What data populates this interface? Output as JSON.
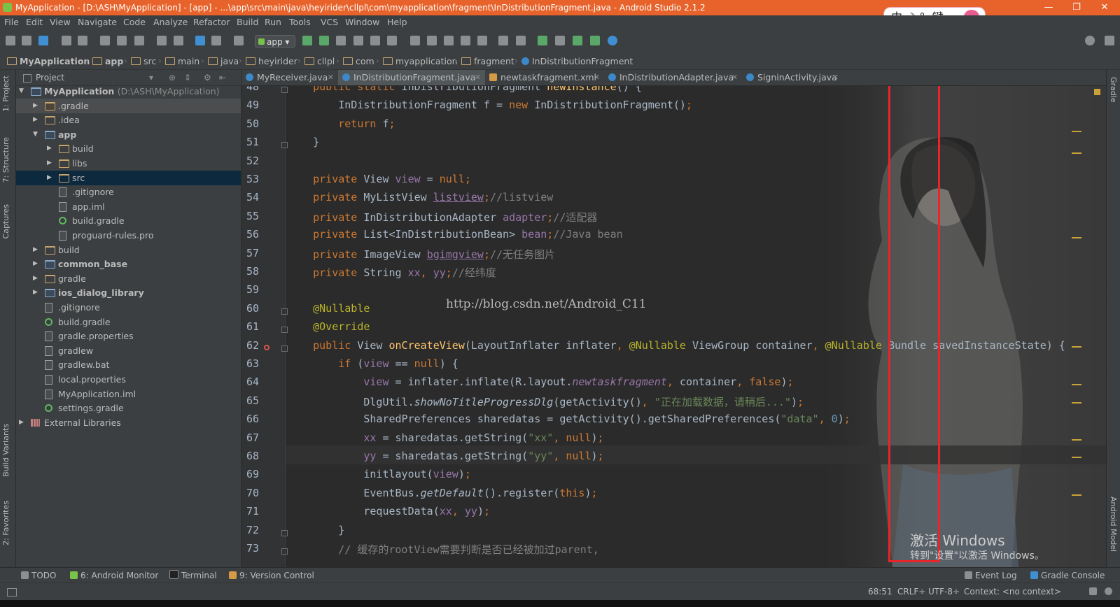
{
  "window": {
    "title": "MyApplication - [D:\\ASH\\MyApplication] - [app] - ...\\app\\src\\main\\java\\heyirider\\cllpl\\com\\myapplication\\fragment\\InDistributionFragment.java - Android Studio 2.1.2",
    "minimize": "—",
    "restore": "❐",
    "close": "✕"
  },
  "ime": {
    "text": "中 ☽ °, 键"
  },
  "menu": [
    "File",
    "Edit",
    "View",
    "Navigate",
    "Code",
    "Analyze",
    "Refactor",
    "Build",
    "Run",
    "Tools",
    "VCS",
    "Window",
    "Help"
  ],
  "toolbar": {
    "run_config": "app"
  },
  "breadcrumb": [
    "MyApplication",
    "app",
    "src",
    "main",
    "java",
    "heyirider",
    "cllpl",
    "com",
    "myapplication",
    "fragment",
    "InDistributionFragment"
  ],
  "left_strip": [
    "1: Project",
    "7: Structure",
    "Captures",
    "Build Variants",
    "2: Favorites"
  ],
  "right_strip": [
    "Gradle",
    "Android Model"
  ],
  "project_panel": {
    "header": "Project",
    "tree": [
      {
        "label": "MyApplication",
        "path": "(D:\\ASH\\MyApplication)",
        "depth": 0,
        "expanded": true,
        "icon": "module-folder",
        "bold": true
      },
      {
        "label": ".gradle",
        "depth": 1,
        "expanded": false,
        "icon": "folder-mod"
      },
      {
        "label": ".idea",
        "depth": 1,
        "expanded": false,
        "icon": "folder"
      },
      {
        "label": "app",
        "depth": 1,
        "expanded": true,
        "icon": "module-folder",
        "bold": true
      },
      {
        "label": "build",
        "depth": 2,
        "expanded": false,
        "icon": "folder"
      },
      {
        "label": "libs",
        "depth": 2,
        "expanded": false,
        "icon": "folder"
      },
      {
        "label": "src",
        "depth": 2,
        "expanded": false,
        "icon": "folder",
        "selected": true
      },
      {
        "label": ".gitignore",
        "depth": 2,
        "icon": "file"
      },
      {
        "label": "app.iml",
        "depth": 2,
        "icon": "file"
      },
      {
        "label": "build.gradle",
        "depth": 2,
        "icon": "gradle"
      },
      {
        "label": "proguard-rules.pro",
        "depth": 2,
        "icon": "file"
      },
      {
        "label": "build",
        "depth": 1,
        "expanded": false,
        "icon": "folder"
      },
      {
        "label": "common_base",
        "depth": 1,
        "expanded": false,
        "icon": "module-folder",
        "bold": true
      },
      {
        "label": "gradle",
        "depth": 1,
        "expanded": false,
        "icon": "folder"
      },
      {
        "label": "ios_dialog_library",
        "depth": 1,
        "expanded": false,
        "icon": "module-folder",
        "bold": true
      },
      {
        "label": ".gitignore",
        "depth": 1,
        "icon": "file"
      },
      {
        "label": "build.gradle",
        "depth": 1,
        "icon": "gradle"
      },
      {
        "label": "gradle.properties",
        "depth": 1,
        "icon": "file"
      },
      {
        "label": "gradlew",
        "depth": 1,
        "icon": "file"
      },
      {
        "label": "gradlew.bat",
        "depth": 1,
        "icon": "file"
      },
      {
        "label": "local.properties",
        "depth": 1,
        "icon": "file"
      },
      {
        "label": "MyApplication.iml",
        "depth": 1,
        "icon": "file"
      },
      {
        "label": "settings.gradle",
        "depth": 1,
        "icon": "gradle"
      },
      {
        "label": "External Libraries",
        "depth": 0,
        "expanded": false,
        "icon": "library"
      }
    ]
  },
  "tabs": [
    {
      "label": "MyReceiver.java",
      "kind": "class"
    },
    {
      "label": "InDistributionFragment.java",
      "kind": "class",
      "active": true
    },
    {
      "label": "newtaskfragment.xml",
      "kind": "xml"
    },
    {
      "label": "InDistributionAdapter.java",
      "kind": "class"
    },
    {
      "label": "SigninActivity.java",
      "kind": "class"
    }
  ],
  "editor": {
    "watermark": "http://blog.csdn.net/Android_C11",
    "activation_title": "激活 Windows",
    "activation_sub": "转到\"设置\"以激活 Windows。",
    "colors": {
      "keyword": "#cc7832",
      "field": "#9876aa",
      "string": "#6a8759",
      "comment": "#808080",
      "annotation": "#bbb529",
      "method": "#ffc66d",
      "text": "#a9b7c6",
      "number": "#6897bb"
    },
    "lines": [
      {
        "n": "48",
        "seg": [
          [
            "    ",
            "text"
          ],
          [
            "public static ",
            "keyword"
          ],
          [
            "InDistributionFragment ",
            "text"
          ],
          [
            "newInstance",
            "method"
          ],
          [
            "() {",
            "text"
          ]
        ]
      },
      {
        "n": "49",
        "seg": [
          [
            "        InDistributionFragment ",
            "text"
          ],
          [
            "f",
            "text"
          ],
          [
            " = ",
            "text"
          ],
          [
            "new ",
            "keyword"
          ],
          [
            "InDistributionFragment()",
            "text"
          ],
          [
            ";",
            "keyword"
          ]
        ]
      },
      {
        "n": "50",
        "seg": [
          [
            "        ",
            "text"
          ],
          [
            "return ",
            "keyword"
          ],
          [
            "f",
            "text"
          ],
          [
            ";",
            "keyword"
          ]
        ]
      },
      {
        "n": "51",
        "seg": [
          [
            "    }",
            "text"
          ]
        ]
      },
      {
        "n": "52",
        "seg": []
      },
      {
        "n": "53",
        "seg": [
          [
            "    ",
            "text"
          ],
          [
            "private ",
            "keyword"
          ],
          [
            "View ",
            "text"
          ],
          [
            "view",
            "field"
          ],
          [
            " = ",
            "text"
          ],
          [
            "null",
            "keyword"
          ],
          [
            ";",
            "keyword"
          ]
        ]
      },
      {
        "n": "54",
        "seg": [
          [
            "    ",
            "text"
          ],
          [
            "private ",
            "keyword"
          ],
          [
            "MyListView ",
            "text"
          ],
          [
            "listview",
            "field"
          ],
          [
            ";",
            "keyword"
          ],
          [
            "//listview",
            "comment"
          ]
        ]
      },
      {
        "n": "55",
        "seg": [
          [
            "    ",
            "text"
          ],
          [
            "private ",
            "keyword"
          ],
          [
            "InDistributionAdapter ",
            "text"
          ],
          [
            "adapter",
            "field"
          ],
          [
            ";",
            "keyword"
          ],
          [
            "//适配器",
            "comment"
          ]
        ]
      },
      {
        "n": "56",
        "seg": [
          [
            "    ",
            "text"
          ],
          [
            "private ",
            "keyword"
          ],
          [
            "List<InDistributionBean> ",
            "text"
          ],
          [
            "bean",
            "field"
          ],
          [
            ";",
            "keyword"
          ],
          [
            "//Java bean",
            "comment"
          ]
        ]
      },
      {
        "n": "57",
        "seg": [
          [
            "    ",
            "text"
          ],
          [
            "private ",
            "keyword"
          ],
          [
            "ImageView ",
            "text"
          ],
          [
            "bgimgview",
            "field"
          ],
          [
            ";",
            "keyword"
          ],
          [
            "//无任务图片",
            "comment"
          ]
        ]
      },
      {
        "n": "58",
        "seg": [
          [
            "    ",
            "text"
          ],
          [
            "private ",
            "keyword"
          ],
          [
            "String ",
            "text"
          ],
          [
            "xx",
            "field"
          ],
          [
            ", ",
            "keyword"
          ],
          [
            "yy",
            "field"
          ],
          [
            ";",
            "keyword"
          ],
          [
            "//经纬度",
            "comment"
          ]
        ]
      },
      {
        "n": "59",
        "seg": []
      },
      {
        "n": "60",
        "seg": [
          [
            "    ",
            "text"
          ],
          [
            "@Nullable",
            "annotation"
          ]
        ]
      },
      {
        "n": "61",
        "seg": [
          [
            "    ",
            "text"
          ],
          [
            "@Override",
            "annotation"
          ]
        ]
      },
      {
        "n": "62",
        "seg": [
          [
            "    ",
            "text"
          ],
          [
            "public ",
            "keyword"
          ],
          [
            "View ",
            "text"
          ],
          [
            "onCreateView",
            "method"
          ],
          [
            "(LayoutInflater inflater",
            "text"
          ],
          [
            ", ",
            "keyword"
          ],
          [
            "@Nullable ",
            "annotation"
          ],
          [
            "ViewGroup container",
            "text"
          ],
          [
            ", ",
            "keyword"
          ],
          [
            "@Nullable ",
            "annotation"
          ],
          [
            "Bundle savedInstanceState) {",
            "text"
          ]
        ]
      },
      {
        "n": "63",
        "seg": [
          [
            "        ",
            "text"
          ],
          [
            "if ",
            "keyword"
          ],
          [
            "(",
            "text"
          ],
          [
            "view",
            "field"
          ],
          [
            " == ",
            "text"
          ],
          [
            "null",
            "keyword"
          ],
          [
            ") {",
            "text"
          ]
        ]
      },
      {
        "n": "64",
        "seg": [
          [
            "            ",
            "text"
          ],
          [
            "view",
            "field"
          ],
          [
            " = inflater.inflate(R.layout.",
            "text"
          ],
          [
            "newtaskfragment",
            "field"
          ],
          [
            ", ",
            "keyword"
          ],
          [
            "container",
            "text"
          ],
          [
            ", ",
            "keyword"
          ],
          [
            "false",
            "keyword"
          ],
          [
            ")",
            "text"
          ],
          [
            ";",
            "keyword"
          ]
        ]
      },
      {
        "n": "65",
        "seg": [
          [
            "            DlgUtil.",
            "text"
          ],
          [
            "showNoTitleProgressDlg",
            "text"
          ],
          [
            "(getActivity()",
            "text"
          ],
          [
            ", ",
            "keyword"
          ],
          [
            "\"正在加载数据，请稍后...\"",
            "string"
          ],
          [
            ")",
            "text"
          ],
          [
            ";",
            "keyword"
          ]
        ]
      },
      {
        "n": "66",
        "seg": [
          [
            "            SharedPreferences sharedatas = getActivity().getSharedPreferences(",
            "text"
          ],
          [
            "\"data\"",
            "string"
          ],
          [
            ", ",
            "keyword"
          ],
          [
            "0",
            "number"
          ],
          [
            ")",
            "text"
          ],
          [
            ";",
            "keyword"
          ]
        ]
      },
      {
        "n": "67",
        "seg": [
          [
            "            ",
            "text"
          ],
          [
            "xx",
            "field"
          ],
          [
            " = sharedatas.getString(",
            "text"
          ],
          [
            "\"xx\"",
            "string"
          ],
          [
            ", ",
            "keyword"
          ],
          [
            "null",
            "keyword"
          ],
          [
            ")",
            "text"
          ],
          [
            ";",
            "keyword"
          ]
        ]
      },
      {
        "n": "68",
        "seg": [
          [
            "            ",
            "text"
          ],
          [
            "yy",
            "field"
          ],
          [
            " = sharedatas.getString(",
            "text"
          ],
          [
            "\"yy\"",
            "string"
          ],
          [
            ", ",
            "keyword"
          ],
          [
            "null",
            "keyword"
          ],
          [
            ")",
            "text"
          ],
          [
            ";",
            "keyword"
          ]
        ]
      },
      {
        "n": "69",
        "seg": [
          [
            "            initlayout(",
            "text"
          ],
          [
            "view",
            "field"
          ],
          [
            ")",
            "text"
          ],
          [
            ";",
            "keyword"
          ]
        ]
      },
      {
        "n": "70",
        "seg": [
          [
            "            EventBus.",
            "text"
          ],
          [
            "getDefault",
            "text"
          ],
          [
            "().register(",
            "text"
          ],
          [
            "this",
            "keyword"
          ],
          [
            ")",
            "text"
          ],
          [
            ";",
            "keyword"
          ]
        ]
      },
      {
        "n": "71",
        "seg": [
          [
            "            requestData(",
            "text"
          ],
          [
            "xx",
            "field"
          ],
          [
            ", ",
            "keyword"
          ],
          [
            "yy",
            "field"
          ],
          [
            ")",
            "text"
          ],
          [
            ";",
            "keyword"
          ]
        ]
      },
      {
        "n": "72",
        "seg": [
          [
            "        }",
            "text"
          ]
        ]
      },
      {
        "n": "73",
        "seg": [
          [
            "        ",
            "text"
          ],
          [
            "// 缓存的rootView需要判断是否已经被加过parent,",
            "comment"
          ]
        ]
      }
    ]
  },
  "tool_windows": [
    {
      "label": "TODO",
      "icon": "todo-icon"
    },
    {
      "label": "6: Android Monitor",
      "icon": "android-icon"
    },
    {
      "label": "Terminal",
      "icon": "terminal-icon"
    },
    {
      "label": "9: Version Control",
      "icon": "vcs-icon"
    },
    {
      "label": "Event Log",
      "icon": "event-log-icon"
    },
    {
      "label": "Gradle Console",
      "icon": "gradle-console-icon"
    }
  ],
  "status": {
    "position": "68:51",
    "line_sep": "CRLF÷",
    "encoding": "UTF-8÷",
    "context": "Context: <no context>"
  }
}
